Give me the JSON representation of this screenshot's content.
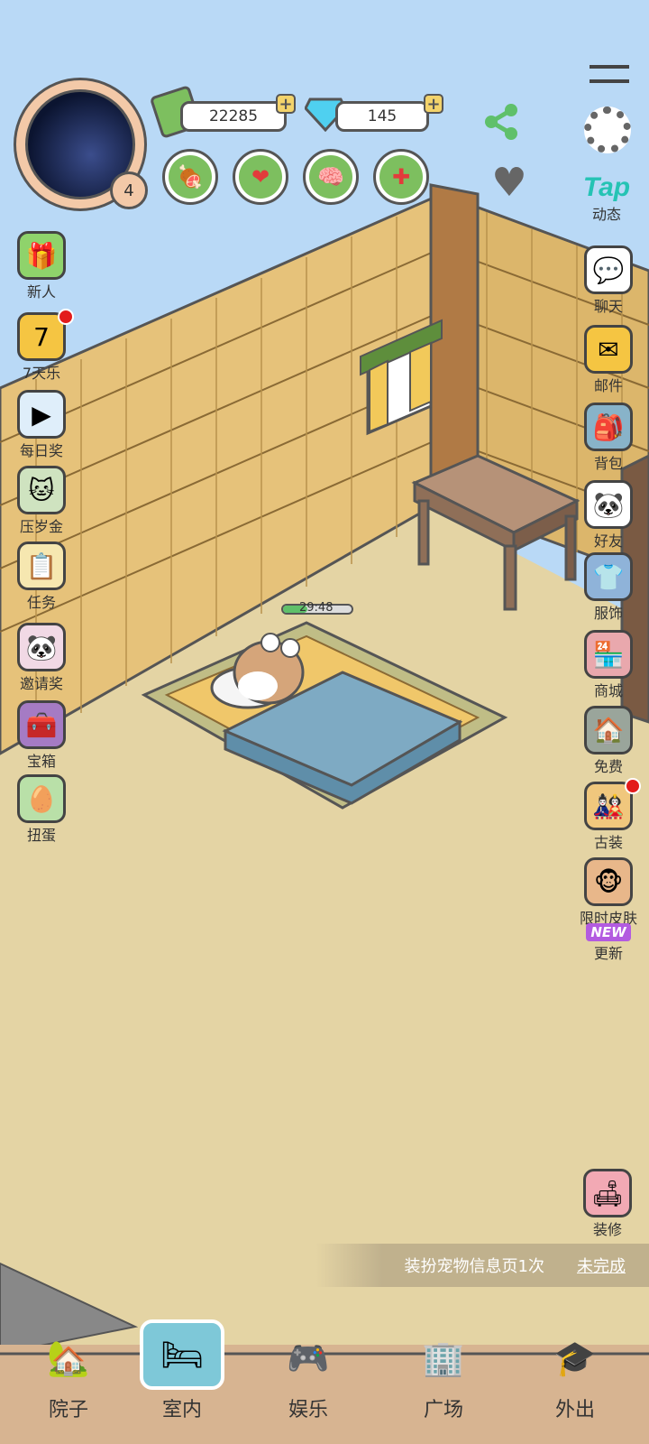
{
  "profile": {
    "level": "4"
  },
  "currency": {
    "cash": "22285",
    "gems": "145"
  },
  "needs": [
    {
      "name": "food-icon",
      "glyph": "🍖"
    },
    {
      "name": "heart-icon",
      "glyph": "❤"
    },
    {
      "name": "brain-icon",
      "glyph": "🧠"
    },
    {
      "name": "health-icon",
      "glyph": "✚"
    }
  ],
  "top_right": {
    "tap_logo": "Tap",
    "tap_label": "动态"
  },
  "left_menu": [
    {
      "name": "newbie",
      "label": "新人",
      "icon": "gift-icon",
      "glyph": "🎁",
      "color": "#8fd36b",
      "dot": false
    },
    {
      "name": "seven-day",
      "label": "7天乐",
      "icon": "seven-icon",
      "glyph": "7",
      "color": "#f5c542",
      "dot": true
    },
    {
      "name": "daily-reward",
      "label": "每日奖",
      "icon": "video-icon",
      "glyph": "▶",
      "color": "#dfeefa",
      "dot": false
    },
    {
      "name": "red-envelope",
      "label": "压岁金",
      "icon": "cat-money-icon",
      "glyph": "🐱",
      "color": "#cfe3c0",
      "dot": false
    },
    {
      "name": "tasks",
      "label": "任务",
      "icon": "calendar-icon",
      "glyph": "📋",
      "color": "#f6e7b0",
      "dot": false
    },
    {
      "name": "invite",
      "label": "邀请奖",
      "icon": "panda-invite-icon",
      "glyph": "🐼",
      "color": "#f1d9e5",
      "dot": false
    },
    {
      "name": "treasure",
      "label": "宝箱",
      "icon": "chest-icon",
      "glyph": "🧰",
      "color": "#a57bc4",
      "dot": false
    },
    {
      "name": "gacha",
      "label": "扭蛋",
      "icon": "gacha-icon",
      "glyph": "🥚",
      "color": "#b9e0a8",
      "dot": false
    }
  ],
  "right_menu": [
    {
      "name": "chat",
      "label": "聊天",
      "icon": "chat-bubble-icon",
      "glyph": "💬",
      "color": "#ffffff",
      "dot": false
    },
    {
      "name": "mail",
      "label": "邮件",
      "icon": "mail-icon",
      "glyph": "✉",
      "color": "#f5c542",
      "dot": false
    },
    {
      "name": "bag",
      "label": "背包",
      "icon": "backpack-icon",
      "glyph": "🎒",
      "color": "#88b3c9",
      "dot": false
    },
    {
      "name": "friends",
      "label": "好友",
      "icon": "panda-friends-icon",
      "glyph": "🐼",
      "color": "#ffffff",
      "dot": false
    },
    {
      "name": "clothes",
      "label": "服饰",
      "icon": "shirt-icon",
      "glyph": "👕",
      "color": "#8fb3d9",
      "dot": false
    },
    {
      "name": "shop",
      "label": "商城",
      "icon": "shop-icon",
      "glyph": "🏪",
      "color": "#e9a8ad",
      "dot": false
    },
    {
      "name": "free",
      "label": "免费",
      "icon": "house-icon",
      "glyph": "🏠",
      "color": "#9aa59b",
      "dot": false
    },
    {
      "name": "ancient",
      "label": "古装",
      "icon": "costume-icon",
      "glyph": "🎎",
      "color": "#f0c77d",
      "dot": true
    },
    {
      "name": "skins",
      "label": "限时皮肤",
      "icon": "monkey-skin-icon",
      "glyph": "🐵",
      "color": "#e8b78a",
      "dot": false
    }
  ],
  "update": {
    "badge": "NEW",
    "label": "更新"
  },
  "decorate": {
    "label": "装修"
  },
  "timer": {
    "value": "29:48"
  },
  "quest": {
    "text": "装扮宠物信息页1次",
    "status": "未完成"
  },
  "bottom_nav": [
    {
      "name": "yard",
      "label": "院子",
      "icon": "house-red-icon",
      "glyph": "🏡",
      "active": false
    },
    {
      "name": "indoor",
      "label": "室内",
      "icon": "bed-icon",
      "glyph": "🛏",
      "active": true
    },
    {
      "name": "entertainment",
      "label": "娱乐",
      "icon": "gamepad-icon",
      "glyph": "🎮",
      "active": false
    },
    {
      "name": "square",
      "label": "广场",
      "icon": "building-icon",
      "glyph": "🏢",
      "active": false
    },
    {
      "name": "outing",
      "label": "外出",
      "icon": "briefcase-icon",
      "glyph": "🎓",
      "active": false
    }
  ],
  "colors": {
    "sky": "#b9d9f6",
    "floor": "#e4d4a4",
    "hay": "#e6c27a",
    "accent_green": "#7dbf5f",
    "tap": "#25c3b4"
  }
}
